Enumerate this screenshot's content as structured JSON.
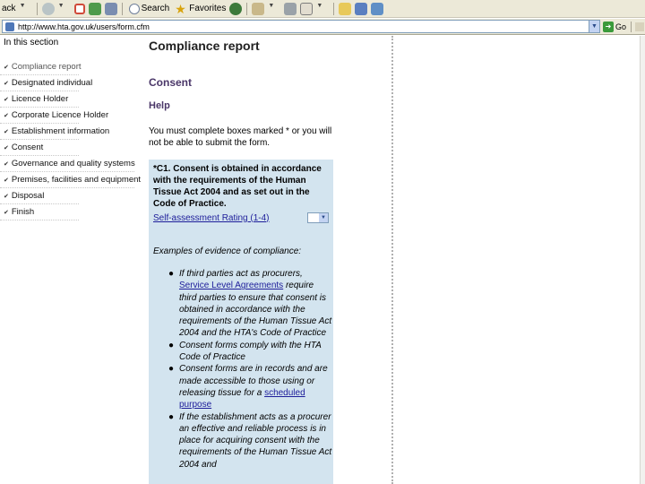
{
  "browser": {
    "toolbar": {
      "back_label": "ack",
      "search_label": "Search",
      "favorites_label": "Favorites"
    },
    "address": {
      "url": "http://www.hta.gov.uk/users/form.cfm",
      "go_label": "Go"
    }
  },
  "nav": {
    "heading": "In this section",
    "items": [
      {
        "label": "Compliance report",
        "state": "active"
      },
      {
        "label": "Designated individual"
      },
      {
        "label": "Licence Holder"
      },
      {
        "label": "Corporate Licence Holder"
      },
      {
        "label": "Establishment information"
      },
      {
        "label": "Consent"
      },
      {
        "label": "Governance and quality systems"
      },
      {
        "label": "Premises, facilities and equipment"
      },
      {
        "label": "Disposal"
      },
      {
        "label": "Finish"
      }
    ]
  },
  "main": {
    "page_title": "Compliance report",
    "section_title": "Consent",
    "help_title": "Help",
    "instruction": "You must complete boxes marked * or you will not be able to submit the form.",
    "question": {
      "title": "*C1. Consent is obtained in accordance with the requirements of the Human Tissue Act 2004 and as set out in the Code of Practice.",
      "rating_link": "Self-assessment Rating (1-4)",
      "rating_value": ""
    },
    "examples_title": "Examples of evidence of compliance:",
    "evidence": {
      "item1_pre": "If third parties act as procurers,",
      "item1_link": "Service Level Agreements",
      "item1_post": "require third parties to ensure that consent is obtained in accordance with the requirements of the Human Tissue Act 2004 and the HTA's Code of Practice",
      "item2": "Consent forms comply with the HTA Code of Practice",
      "item3_pre": "Consent forms are in records and are made accessible to those using or releasing tissue for a",
      "item3_link": "scheduled purpose",
      "item4": "If the establishment acts as a procurer an effective and reliable process is in place for acquiring consent with the requirements of the Human Tissue Act 2004 and"
    }
  },
  "colors": {
    "panel_bg": "#d3e4ef",
    "heading_purple": "#4a3668",
    "link_blue": "#1d1d9a"
  }
}
